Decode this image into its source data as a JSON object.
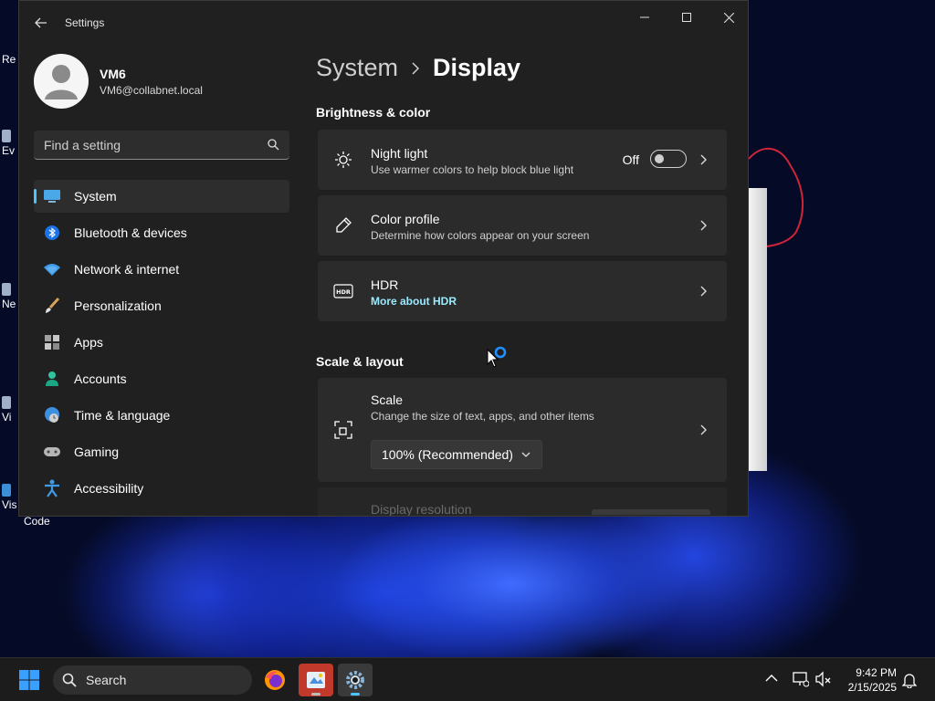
{
  "window": {
    "title": "Settings"
  },
  "profile": {
    "name": "VM6",
    "email": "VM6@collabnet.local"
  },
  "search": {
    "placeholder": "Find a setting"
  },
  "nav": {
    "items": [
      {
        "label": "System",
        "icon": "monitor-icon",
        "active": true
      },
      {
        "label": "Bluetooth & devices",
        "icon": "bluetooth-icon"
      },
      {
        "label": "Network & internet",
        "icon": "wifi-icon"
      },
      {
        "label": "Personalization",
        "icon": "brush-icon"
      },
      {
        "label": "Apps",
        "icon": "apps-icon"
      },
      {
        "label": "Accounts",
        "icon": "person-icon"
      },
      {
        "label": "Time & language",
        "icon": "globe-clock-icon"
      },
      {
        "label": "Gaming",
        "icon": "gamepad-icon"
      },
      {
        "label": "Accessibility",
        "icon": "accessibility-icon"
      }
    ]
  },
  "breadcrumb": {
    "parent": "System",
    "current": "Display"
  },
  "sections": {
    "brightness": {
      "title": "Brightness & color",
      "night_light": {
        "title": "Night light",
        "subtitle": "Use warmer colors to help block blue light",
        "toggle_label": "Off"
      },
      "color_profile": {
        "title": "Color profile",
        "subtitle": "Determine how colors appear on your screen"
      },
      "hdr": {
        "title": "HDR",
        "link": "More about HDR"
      }
    },
    "scale_layout": {
      "title": "Scale & layout",
      "scale": {
        "title": "Scale",
        "subtitle": "Change the size of text, apps, and other items",
        "value": "100% (Recommended)"
      },
      "display_resolution": {
        "title": "Display resolution"
      }
    }
  },
  "desktop": {
    "icons": [
      "Re",
      "Ev",
      "Ne",
      "Vi",
      "Vis",
      "Code"
    ]
  },
  "taskbar": {
    "search_label": "Search",
    "time": "9:42 PM",
    "date": "2/15/2025"
  },
  "colors": {
    "accent": "#4cc2ff",
    "link": "#99ebff",
    "card": "#2b2b2b",
    "window": "#202020"
  }
}
